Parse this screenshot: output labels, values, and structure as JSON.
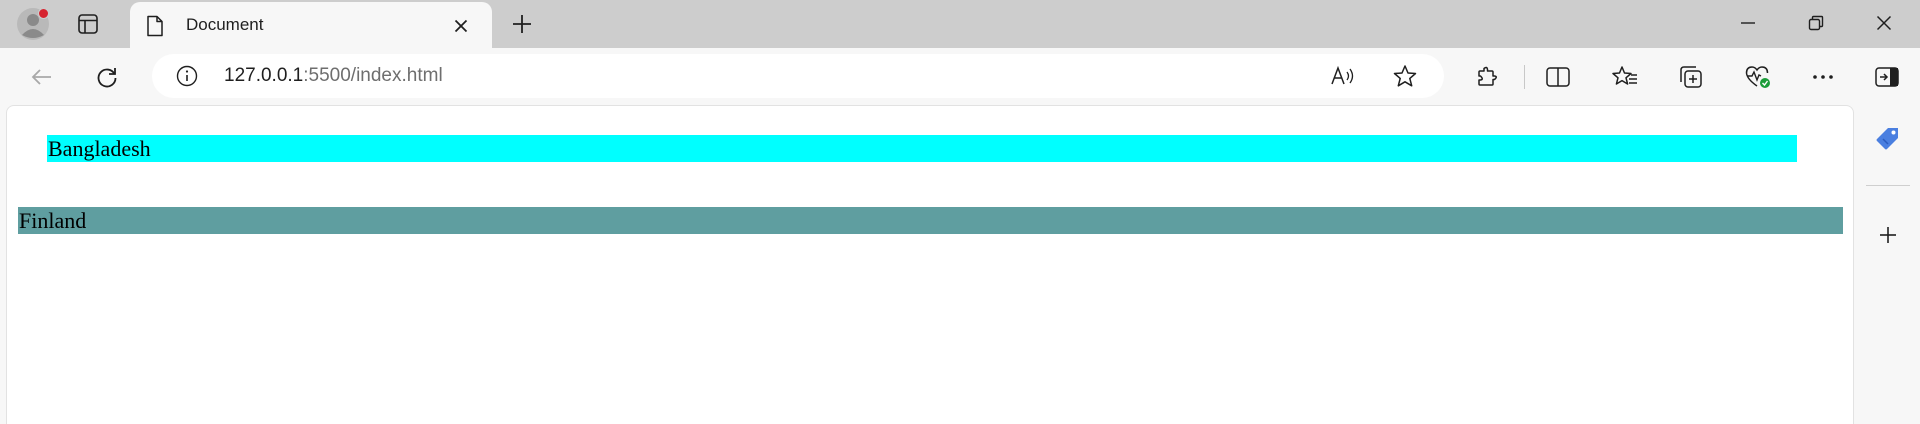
{
  "tab": {
    "title": "Document"
  },
  "address_bar": {
    "url_host": "127.0.0.1",
    "url_rest": ":5500/index.html"
  },
  "toolbar": {
    "icons": [
      "back-icon",
      "refresh-icon",
      "info-icon",
      "read-aloud-icon",
      "favorite-star-icon",
      "extensions-icon",
      "split-screen-icon",
      "favorites-icon",
      "collections-icon",
      "browser-essentials-icon",
      "more-icon",
      "sidebar-toggle-icon"
    ]
  },
  "sidebar": {
    "icons": [
      "shopping-tag-icon",
      "add-icon"
    ]
  },
  "page": {
    "items": [
      {
        "label": "Bangladesh",
        "color": "#00ffff"
      },
      {
        "label": "Finland",
        "color": "#5f9ea0"
      }
    ]
  },
  "colors": {
    "tab_strip": "#cdcdcd",
    "toolbar": "#f7f7f7",
    "notification_dot": "#d6232f",
    "accent_blue": "#4a7fe0"
  }
}
